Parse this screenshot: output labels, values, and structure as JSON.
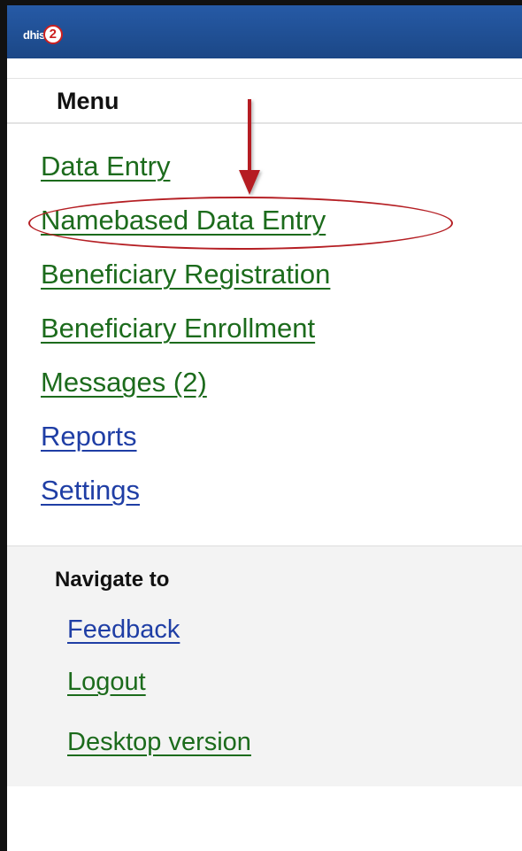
{
  "header": {
    "logo_text": "dhis",
    "logo_badge": "2",
    "bar_color": "#1f4e93"
  },
  "menu": {
    "title": "Menu",
    "items": [
      {
        "label": "Data Entry",
        "color": "green"
      },
      {
        "label": "Namebased Data Entry",
        "color": "green",
        "highlighted": true
      },
      {
        "label": "Beneficiary Registration",
        "color": "green"
      },
      {
        "label": "Beneficiary Enrollment",
        "color": "green"
      },
      {
        "label": "Messages (2)",
        "color": "green"
      },
      {
        "label": "Reports",
        "color": "blue"
      },
      {
        "label": "Settings",
        "color": "blue"
      }
    ]
  },
  "navigate": {
    "title": "Navigate to",
    "items": [
      {
        "label": "Feedback",
        "color": "blue"
      },
      {
        "label": "Logout",
        "color": "green"
      },
      {
        "label": "Desktop version",
        "color": "green"
      }
    ]
  },
  "annotation": {
    "type": "red-arrow-and-ellipse",
    "target": "Namebased Data Entry",
    "color": "#b51f24"
  },
  "colors": {
    "link_green": "#1c6b1c",
    "link_blue": "#1f3ea5",
    "nav_background": "#f3f3f3"
  }
}
